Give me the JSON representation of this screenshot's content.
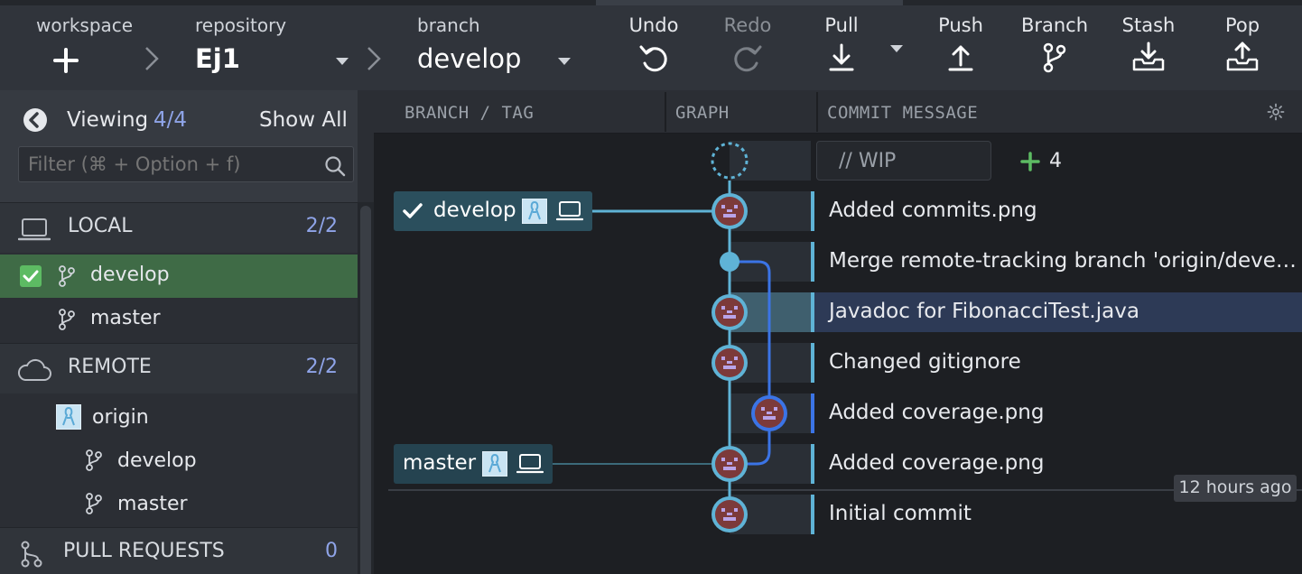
{
  "toolbar": {
    "workspace_label": "workspace",
    "repository_label": "repository",
    "repository_value": "Ej1",
    "branch_label": "branch",
    "branch_value": "develop",
    "buttons": {
      "undo": "Undo",
      "redo": "Redo",
      "pull": "Pull",
      "push": "Push",
      "branch": "Branch",
      "stash": "Stash",
      "pop": "Pop"
    }
  },
  "sidebar": {
    "viewing_label": "Viewing",
    "viewing_count": "4/4",
    "show_all": "Show All",
    "filter_placeholder": "Filter (⌘ + Option + f)",
    "local": {
      "title": "LOCAL",
      "count": "2/2",
      "branches": [
        "develop",
        "master"
      ]
    },
    "remote": {
      "title": "REMOTE",
      "count": "2/2",
      "name": "origin",
      "branches": [
        "develop",
        "master"
      ]
    },
    "pull_requests": {
      "title": "PULL REQUESTS",
      "count": "0"
    }
  },
  "columns": {
    "branch_tag": "BRANCH / TAG",
    "graph": "GRAPH",
    "commit_message": "COMMIT MESSAGE"
  },
  "wip": {
    "label": "// WIP",
    "added": "4"
  },
  "branch_labels": {
    "develop": "develop",
    "master": "master"
  },
  "commits": [
    {
      "message": "Added commits.png"
    },
    {
      "message": "Merge remote-tracking branch 'origin/deve…"
    },
    {
      "message": "Javadoc for FibonacciTest.java"
    },
    {
      "message": "Changed gitignore"
    },
    {
      "message": "Added coverage.png"
    },
    {
      "message": "Added coverage.png"
    },
    {
      "message": "Initial commit"
    }
  ],
  "time_badge": "12 hours ago",
  "colors": {
    "accent_teal": "#5fb3d6",
    "accent_blue": "#3b74e6",
    "selected_row": "#2d3a56",
    "local_selected": "#3f6b46",
    "count": "#8fa4e8",
    "add_green": "#5dbb63"
  }
}
